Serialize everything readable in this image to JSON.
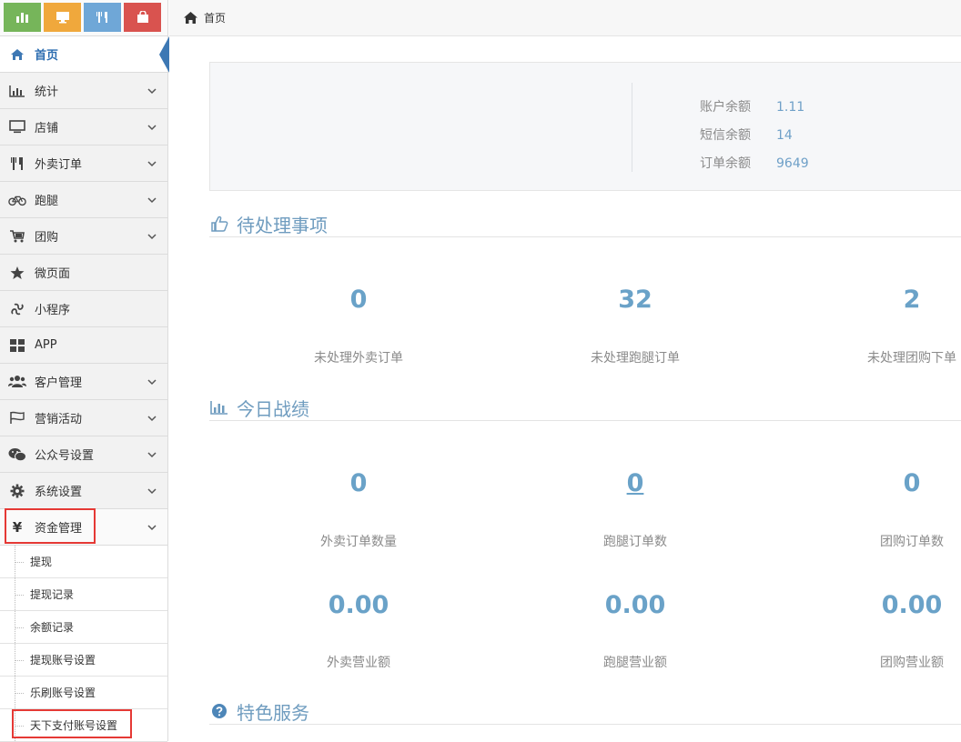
{
  "sidebar": {
    "shortcuts": [
      {
        "icon": "bar-chart-icon",
        "color": "#76b55a"
      },
      {
        "icon": "monitor-icon",
        "color": "#f0a83c"
      },
      {
        "icon": "cutlery-icon",
        "color": "#6fa7d7"
      },
      {
        "icon": "shopping-bag-icon",
        "color": "#d9534f"
      }
    ],
    "menu": [
      {
        "label": "首页",
        "icon": "home-icon",
        "active": true
      },
      {
        "label": "统计",
        "icon": "bar-chart-icon"
      },
      {
        "label": "店铺",
        "icon": "monitor-icon"
      },
      {
        "label": "外卖订单",
        "icon": "cutlery-icon"
      },
      {
        "label": "跑腿",
        "icon": "bicycle-icon"
      },
      {
        "label": "团购",
        "icon": "cart-icon"
      },
      {
        "label": "微页面",
        "icon": "star-icon"
      },
      {
        "label": "小程序",
        "icon": "link-icon"
      },
      {
        "label": "APP",
        "icon": "grid-icon"
      },
      {
        "label": "客户管理",
        "icon": "users-icon"
      },
      {
        "label": "营销活动",
        "icon": "flag-icon"
      },
      {
        "label": "公众号设置",
        "icon": "wechat-icon"
      },
      {
        "label": "系统设置",
        "icon": "gear-icon"
      },
      {
        "label": "资金管理",
        "icon": "yen-icon",
        "expanded": true
      }
    ],
    "submenu": [
      "提现",
      "提现记录",
      "余额记录",
      "提现账号设置",
      "乐刷账号设置",
      "天下支付账号设置"
    ]
  },
  "breadcrumb": {
    "home_label": "首页"
  },
  "balances": [
    {
      "label": "账户余额",
      "value": "1.11"
    },
    {
      "label": "短信余额",
      "value": "14"
    },
    {
      "label": "订单余额",
      "value": "9649"
    }
  ],
  "pending": {
    "title": "待处理事项",
    "items": [
      {
        "value": "0",
        "label": "未处理外卖订单"
      },
      {
        "value": "32",
        "label": "未处理跑腿订单"
      },
      {
        "value": "2",
        "label": "未处理团购下单"
      }
    ]
  },
  "today": {
    "title": "今日战绩",
    "counts": [
      {
        "value": "0",
        "label": "外卖订单数量"
      },
      {
        "value": "0",
        "label": "跑腿订单数"
      },
      {
        "value": "0",
        "label": "团购订单数"
      }
    ],
    "revenue": [
      {
        "value": "0.00",
        "label": "外卖营业额"
      },
      {
        "value": "0.00",
        "label": "跑腿营业额"
      },
      {
        "value": "0.00",
        "label": "团购营业额"
      }
    ]
  },
  "services": {
    "title": "特色服务"
  },
  "colors": {
    "accent": "#6aa2c8",
    "active_menu": "#3d78b4",
    "highlight_box": "#e53935"
  }
}
